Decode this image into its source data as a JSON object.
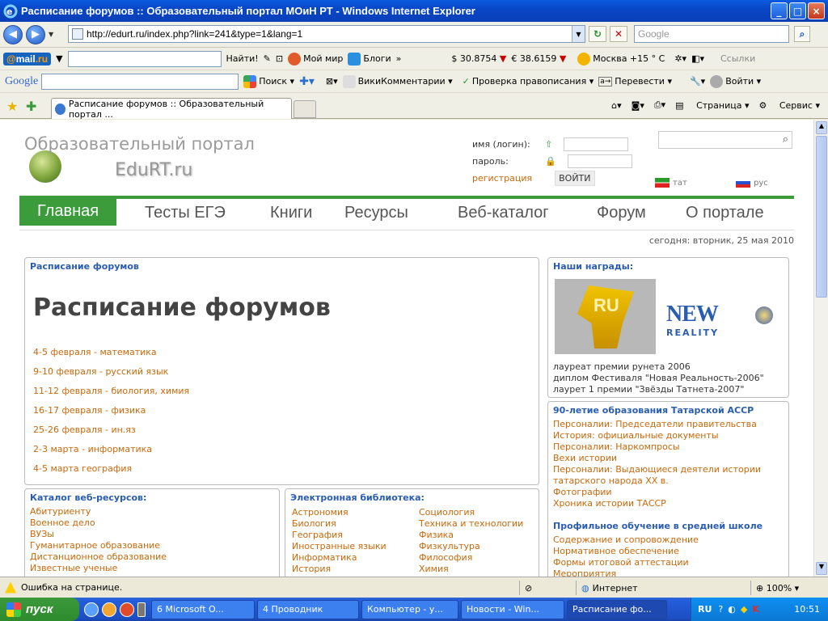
{
  "window": {
    "title": "Расписание форумов :: Образовательный портал МОиН РТ - Windows Internet Explorer",
    "min": "_",
    "max": "□",
    "close": "×"
  },
  "address": {
    "url": "http://edurt.ru/index.php?link=241&type=1&lang=1",
    "search_placeholder": "Google"
  },
  "mailru_bar": {
    "logo_at": "@",
    "logo_mail": "mail",
    "logo_dot": ".ru",
    "find": "Найти!",
    "my_world": "Мой мир",
    "blogs": "Блоги",
    "usd": "$ 30.8754",
    "eur": "€ 38.6159",
    "weather": "Москва +15 ° С",
    "links": "Ссылки"
  },
  "google_bar": {
    "logo": "Google",
    "search": "Поиск",
    "wiki": "ВикиКомментарии",
    "spell": "Проверка правописания",
    "translate": "Перевести",
    "login": "Войти"
  },
  "tabs": {
    "active": "Расписание форумов :: Образовательный портал ...",
    "page_menu": "Страница",
    "service_menu": "Сервис"
  },
  "site": {
    "logo_line1": "Образовательный портал",
    "logo_line2": "EduRT.ru",
    "login_label": "имя (логин):",
    "password_label": "пароль:",
    "register": "регистрация",
    "login_button": "ВОЙТИ",
    "lang_tat": "тат",
    "lang_rus": "рус",
    "menu": [
      "Главная",
      "Тесты ЕГЭ",
      "Книги",
      "Ресурсы",
      "Веб-каталог",
      "Форум",
      "О портале"
    ],
    "date": "сегодня: вторник, 25 мая 2010"
  },
  "main": {
    "crumb": "Расписание форумов",
    "heading": "Расписание форумов",
    "schedule": [
      "4-5 февраля - математика",
      "9-10 февраля - русский язык",
      "11-12 февраля - биология, химия",
      "16-17 февраля - физика",
      "25-26 февраля - ин.яз",
      "2-3 марта - информатика",
      "4-5 марта география"
    ]
  },
  "catalog": {
    "title": "Каталог веб-ресурсов:",
    "items": [
      "Абитуриенту",
      "Военное дело",
      "ВУЗы",
      "Гуманитарное образование",
      "Дистанционное образование",
      "Известные ученые"
    ]
  },
  "library": {
    "title": "Электронная библиотека:",
    "col1": [
      "Астрономия",
      "Биология",
      "География",
      "Иностранные языки",
      "Информатика",
      "История"
    ],
    "col2": [
      "Социология",
      "Техника и технологии",
      "Физика",
      "Физкультура",
      "Философия",
      "Химия"
    ]
  },
  "awards": {
    "title": "Наши награды:",
    "ru_badge": "RU",
    "new_reality": "NEW",
    "reality": "REALITY",
    "lines": [
      "лауреат премии рунета 2006",
      "диплом Фестиваля \"Новая Реальность-2006\"",
      "лаурет 1 премии \"Звёзды Татнета-2007\""
    ]
  },
  "anniv": {
    "title": "90-летие образования Татарской АССР",
    "items": [
      "Персоналии: Председатели правительства",
      "История: официальные документы",
      "Персоналии: Наркомпросы",
      "Вехи истории",
      "Персоналии: Выдающиеся деятели истории татарского народа XX в.",
      "Фотографии",
      "Хроника истории ТАССР"
    ]
  },
  "profile": {
    "title": "Профильное обучение в средней школе",
    "items": [
      "Содержание и сопровождение",
      "Нормативное обеспечение",
      "Формы итоговой аттестации",
      "Мероприятия"
    ]
  },
  "status": {
    "text": "Ошибка на странице.",
    "zone": "Интернет",
    "zoom": "100%"
  },
  "taskbar": {
    "start": "пуск",
    "tasks": [
      "6 Microsoft O...",
      "4 Проводник",
      "Компьютер - у...",
      "Новости - Win...",
      "Расписание фо..."
    ],
    "lang": "RU",
    "clock": "10:51"
  },
  "colors": {
    "accent_green": "#3c9c3c",
    "link_orange": "#c7690b",
    "heading_blue": "#2a5db0"
  }
}
